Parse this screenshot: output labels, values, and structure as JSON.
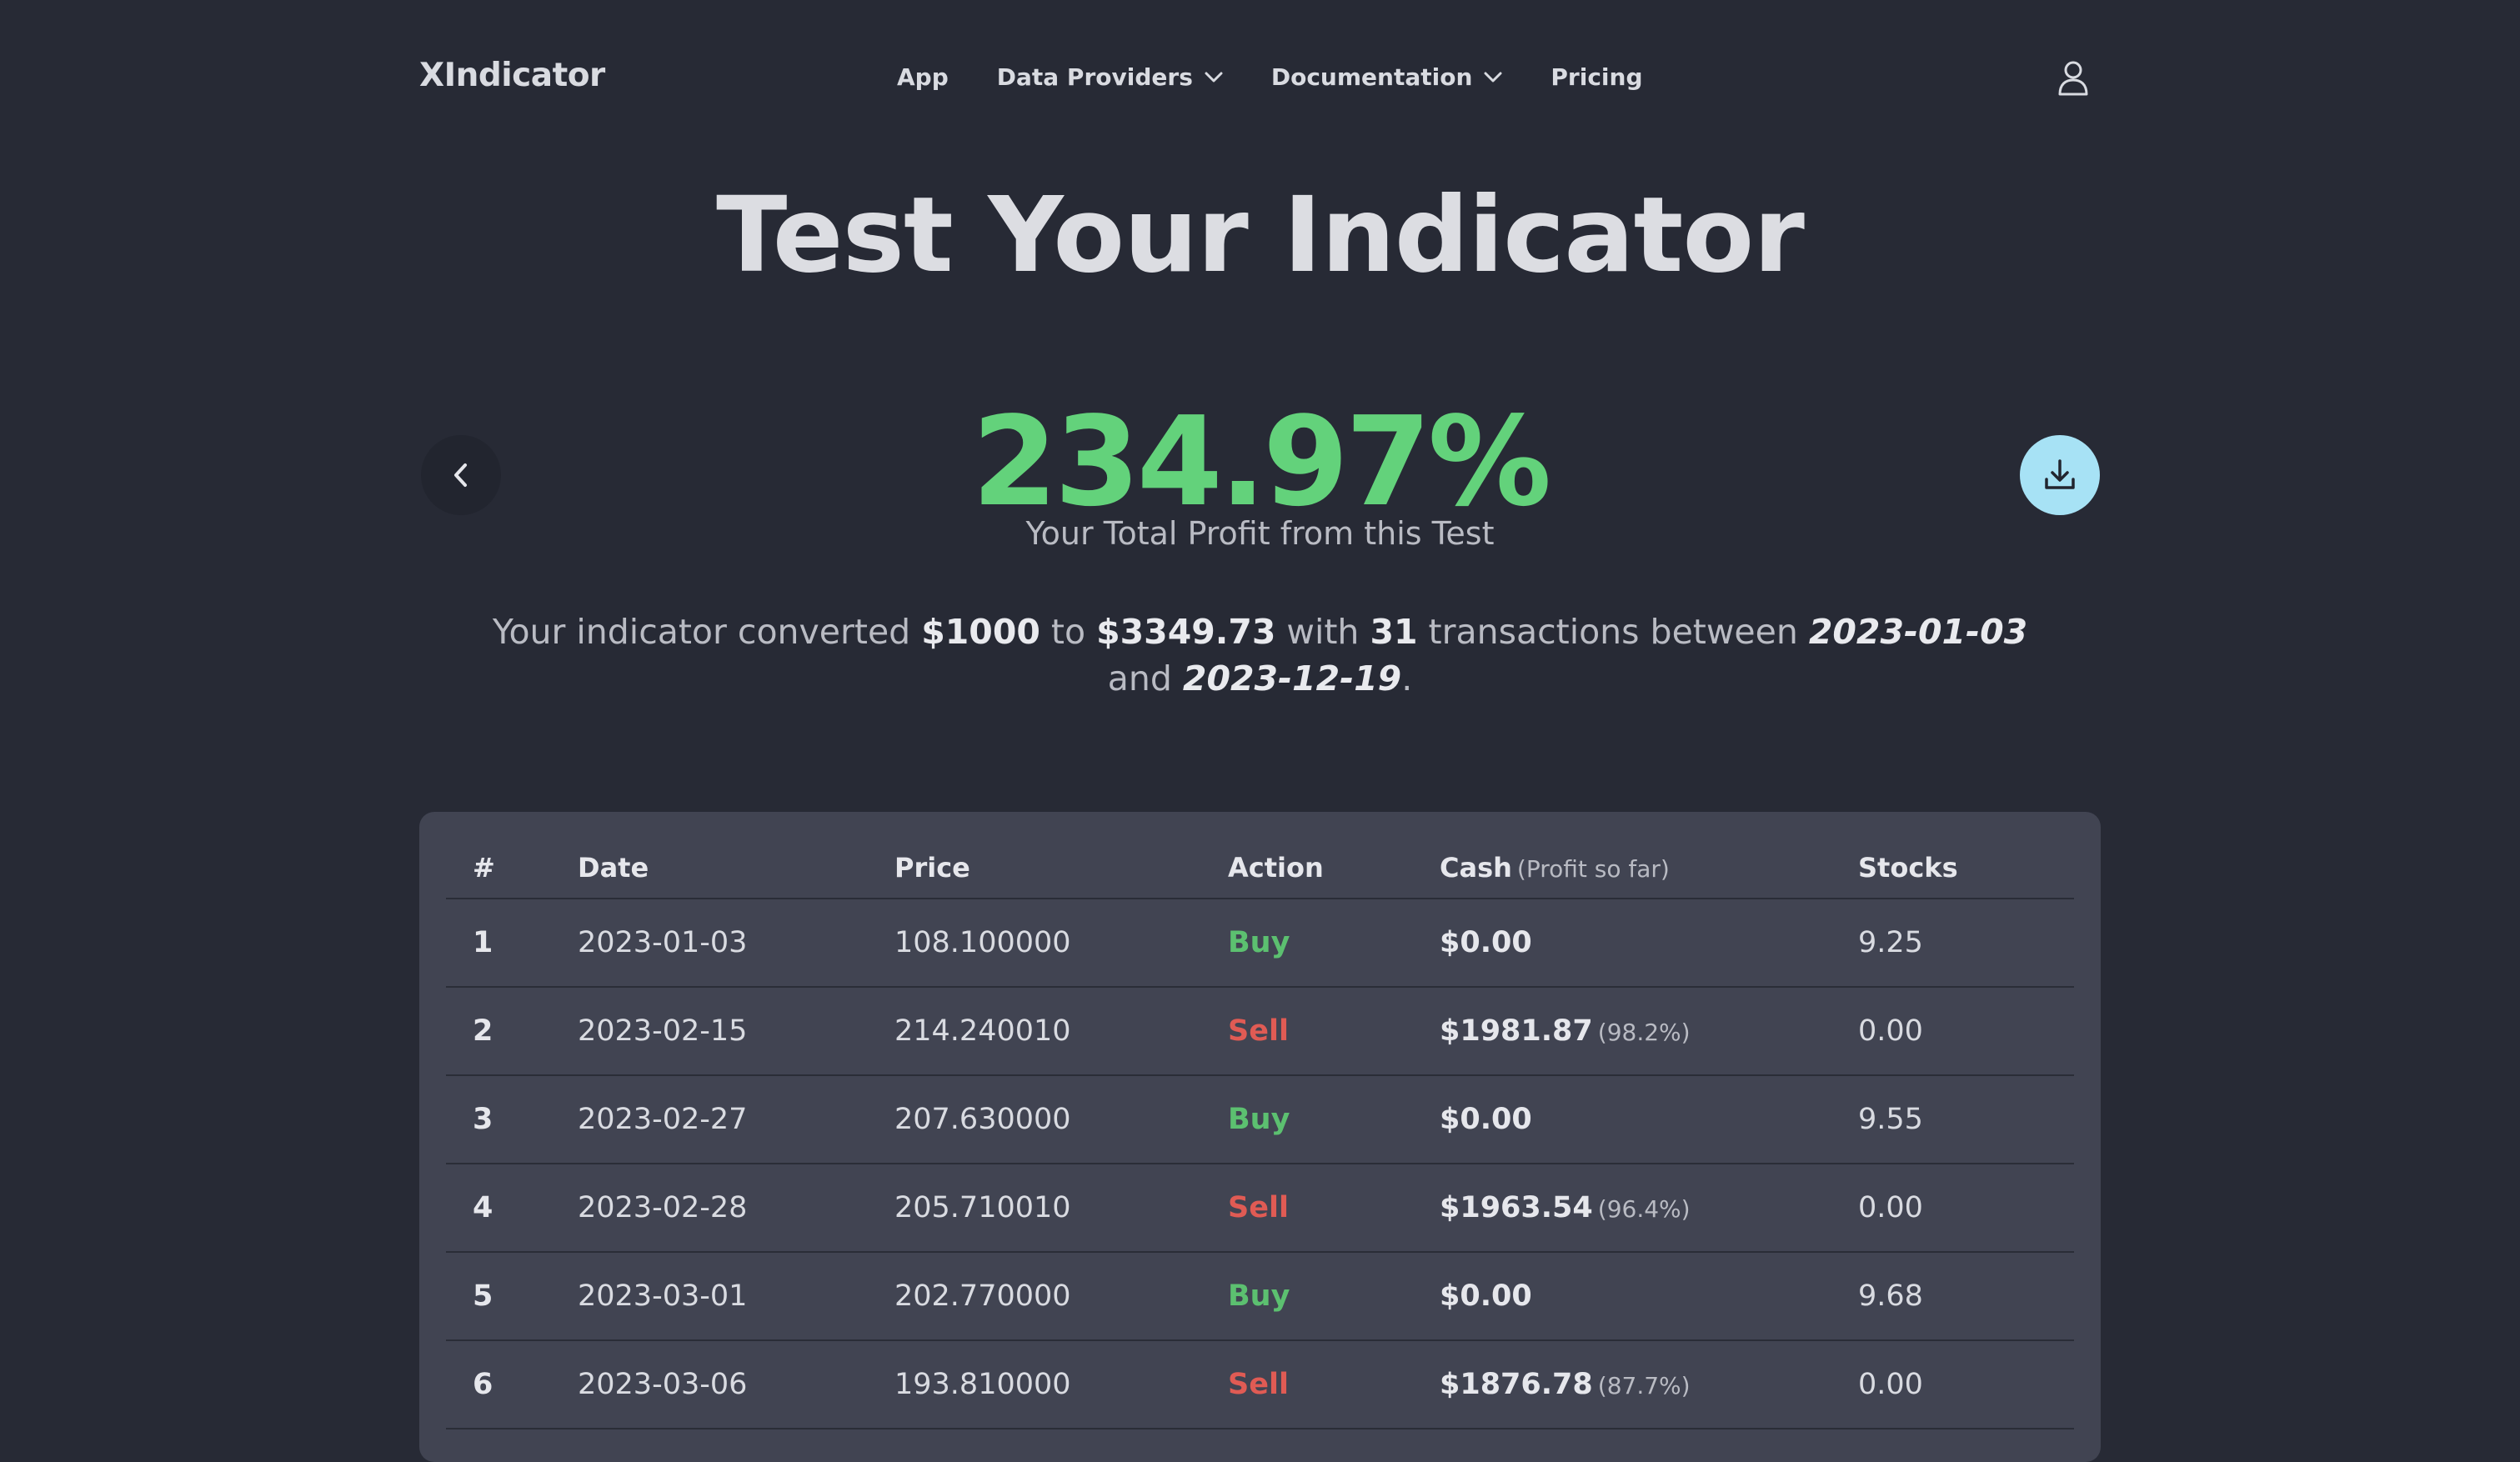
{
  "nav": {
    "brand": "XIndicator",
    "links": [
      {
        "label": "App"
      },
      {
        "label": "Data Providers"
      },
      {
        "label": "Documentation"
      },
      {
        "label": "Pricing"
      }
    ]
  },
  "hero": {
    "title": "Test Your Indicator",
    "profit": "234.97%",
    "profit_caption": "Your Total Profit from this Test"
  },
  "summary": {
    "prefix": "Your indicator converted ",
    "start": "$1000",
    "to": " to ",
    "end": "$3349.73",
    "with": " with ",
    "count": "31",
    "between": " transactions between ",
    "date_from": "2023-01-03",
    "and": " and ",
    "date_to": "2023-12-19",
    "period": "."
  },
  "table": {
    "headers": {
      "num": "#",
      "date": "Date",
      "price": "Price",
      "action": "Action",
      "cash": "Cash",
      "cash_sub": "(Profit so far)",
      "stocks": "Stocks"
    },
    "rows": [
      {
        "n": "1",
        "date": "2023-01-03",
        "price": "108.100000",
        "action": "Buy",
        "cash": "$0.00",
        "pct": "",
        "stocks": "9.25"
      },
      {
        "n": "2",
        "date": "2023-02-15",
        "price": "214.240010",
        "action": "Sell",
        "cash": "$1981.87",
        "pct": "(98.2%)",
        "stocks": "0.00"
      },
      {
        "n": "3",
        "date": "2023-02-27",
        "price": "207.630000",
        "action": "Buy",
        "cash": "$0.00",
        "pct": "",
        "stocks": "9.55"
      },
      {
        "n": "4",
        "date": "2023-02-28",
        "price": "205.710010",
        "action": "Sell",
        "cash": "$1963.54",
        "pct": "(96.4%)",
        "stocks": "0.00"
      },
      {
        "n": "5",
        "date": "2023-03-01",
        "price": "202.770000",
        "action": "Buy",
        "cash": "$0.00",
        "pct": "",
        "stocks": "9.68"
      },
      {
        "n": "6",
        "date": "2023-03-06",
        "price": "193.810000",
        "action": "Sell",
        "cash": "$1876.78",
        "pct": "(87.7%)",
        "stocks": "0.00"
      }
    ]
  },
  "colors": {
    "background": "#272a35",
    "profit_green": "#63d27b",
    "buy_green": "#5cc070",
    "sell_red": "#e05b54",
    "download_button": "#a7e2f5",
    "table_card": "#414452"
  },
  "icons": {
    "user": "user-icon",
    "back": "chevron-left-icon",
    "download": "download-icon",
    "dropdown": "chevron-down-icon"
  }
}
